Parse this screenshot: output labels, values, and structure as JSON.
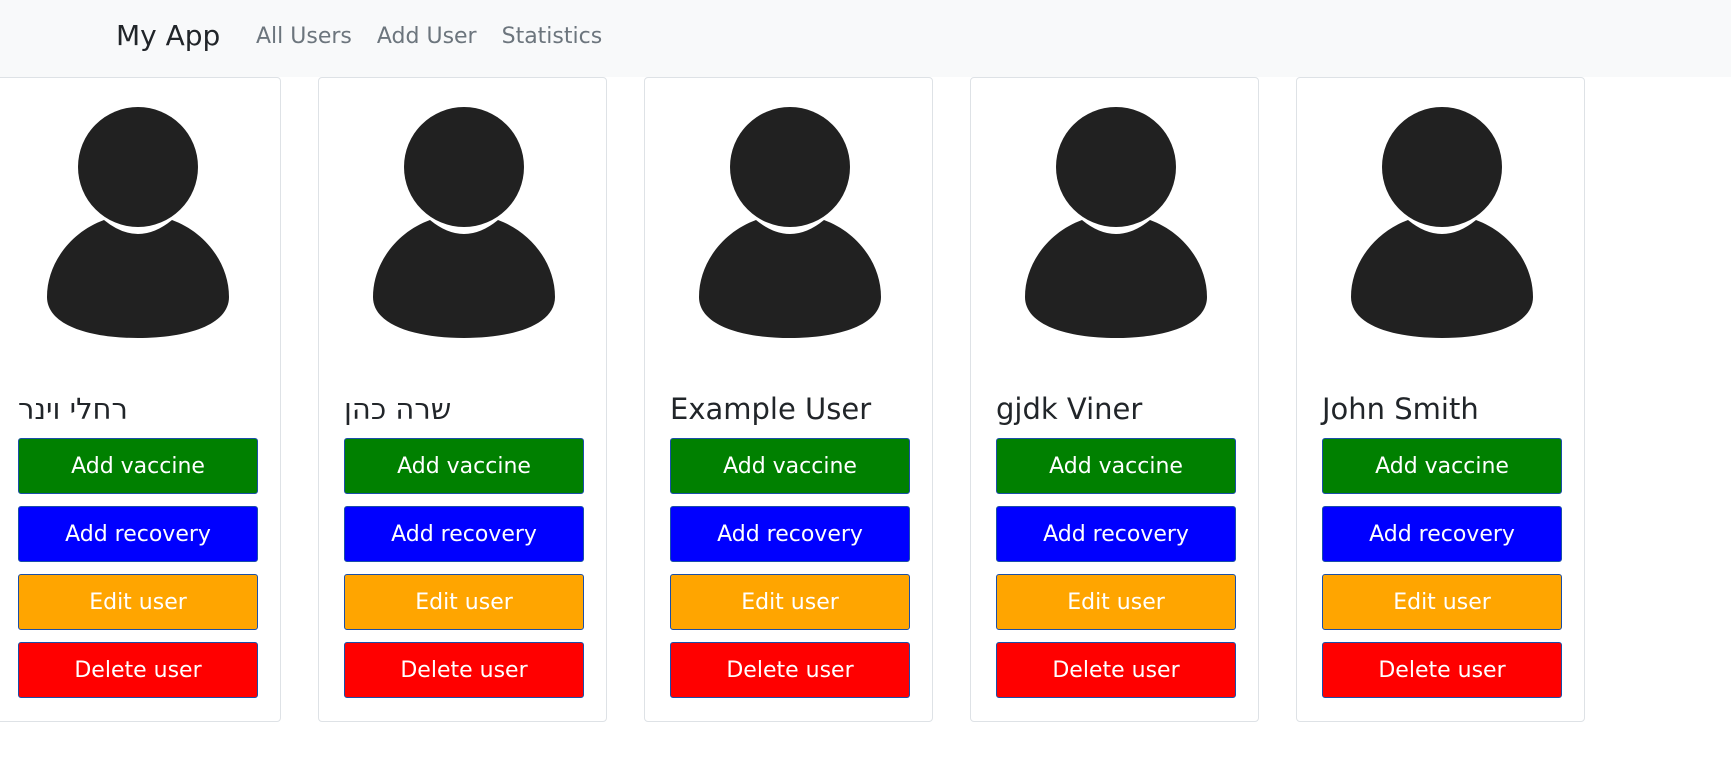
{
  "navbar": {
    "brand": "My App",
    "links": [
      "All Users",
      "Add User",
      "Statistics"
    ]
  },
  "icons": {
    "avatar": "user-silhouette-icon"
  },
  "colors": {
    "add_vaccine": "#008000",
    "add_recovery": "#0000ff",
    "edit_user": "#ffa500",
    "delete_user": "#ff0000",
    "avatar": "#212121"
  },
  "users": [
    {
      "name": "רחלי וינר",
      "buttons": {
        "add_vaccine": "Add vaccine",
        "add_recovery": "Add recovery",
        "edit_user": "Edit user",
        "delete_user": "Delete user"
      }
    },
    {
      "name": "שרה כהן",
      "buttons": {
        "add_vaccine": "Add vaccine",
        "add_recovery": "Add recovery",
        "edit_user": "Edit user",
        "delete_user": "Delete user"
      }
    },
    {
      "name": "Example User",
      "buttons": {
        "add_vaccine": "Add vaccine",
        "add_recovery": "Add recovery",
        "edit_user": "Edit user",
        "delete_user": "Delete user"
      }
    },
    {
      "name": "gjdk Viner",
      "buttons": {
        "add_vaccine": "Add vaccine",
        "add_recovery": "Add recovery",
        "edit_user": "Edit user",
        "delete_user": "Delete user"
      }
    },
    {
      "name": "John Smith",
      "buttons": {
        "add_vaccine": "Add vaccine",
        "add_recovery": "Add recovery",
        "edit_user": "Edit user",
        "delete_user": "Delete user"
      }
    }
  ]
}
